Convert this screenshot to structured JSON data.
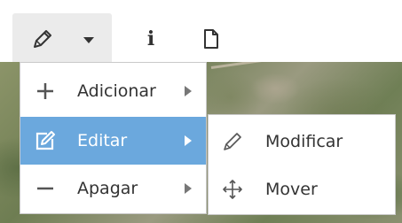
{
  "toolbar": {
    "edit_icon": "pencil-icon",
    "dropdown_icon": "caret-down-icon",
    "info_icon": "info-icon",
    "info_glyph": "i",
    "file_icon": "file-icon"
  },
  "menu": {
    "items": [
      {
        "label": "Adicionar",
        "icon": "plus-icon",
        "has_submenu": true
      },
      {
        "label": "Editar",
        "icon": "edit-square-icon",
        "has_submenu": true,
        "active": true
      },
      {
        "label": "Apagar",
        "icon": "minus-icon",
        "has_submenu": true
      }
    ]
  },
  "submenu": {
    "items": [
      {
        "label": "Modificar",
        "icon": "pencil-icon"
      },
      {
        "label": "Mover",
        "icon": "move-arrows-icon"
      }
    ]
  },
  "colors": {
    "active_bg": "#6ba8dd",
    "toolbar_active_bg": "#ebebeb"
  }
}
